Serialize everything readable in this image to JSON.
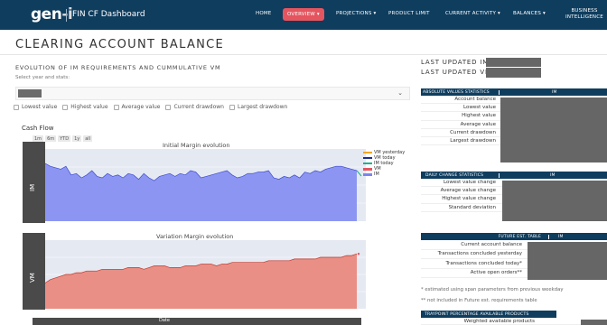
{
  "nav": {
    "logo_main": "gen",
    "logo_dash": "-i",
    "app_title": "FIN CF Dashboard",
    "items": [
      {
        "label": "HOME"
      },
      {
        "label": "OVERVIEW ▾"
      },
      {
        "label": "PROJECTIONS ▾"
      },
      {
        "label": "PRODUCT LIMIT"
      },
      {
        "label": "CURRENT ACTIVITY ▾"
      },
      {
        "label": "BALANCES ▾"
      }
    ],
    "bi_line1": "BUSINESS",
    "bi_line2": "INTELLIGENCE",
    "active_color": "#e4555f",
    "bg_color": "#0f3d5e"
  },
  "page": {
    "title": "CLEARING ACCOUNT BALANCE",
    "section_title": "EVOLUTION OF IM REQUIREMENTS AND CUMMULATIVE VM",
    "select_hint": "Select year and stats:",
    "checkboxes": [
      "Lowest value",
      "Highest value",
      "Average value",
      "Current drawdown",
      "Largest drawdown"
    ]
  },
  "chart_header": {
    "title": "Cash Flow",
    "range_buttons": [
      "1m",
      "6m",
      "YTD",
      "1y",
      "all"
    ]
  },
  "chart_data": [
    {
      "type": "area",
      "title": "Initial Margin evolution",
      "ylabel": "IM",
      "series": [
        {
          "name": "IM",
          "color": "#8c96f2",
          "values": [
            100,
            98,
            97,
            96,
            98,
            92,
            93,
            90,
            92,
            95,
            91,
            90,
            93,
            91,
            92,
            90,
            93,
            92,
            89,
            93,
            90,
            88,
            91,
            92,
            93,
            91,
            93,
            92,
            95,
            94,
            90,
            91,
            92,
            93,
            94,
            95,
            92,
            90,
            91,
            93,
            93,
            94,
            94,
            95,
            90,
            89,
            91,
            90,
            92,
            90,
            94,
            93,
            95,
            94,
            96,
            97,
            98,
            98,
            97,
            96,
            95
          ]
        },
        {
          "name": "VM today",
          "color": "#1f2e8c",
          "values": []
        },
        {
          "name": "IM today",
          "color": "#19b28c",
          "values": []
        }
      ]
    },
    {
      "type": "area",
      "title": "Variation Margin evolution",
      "ylabel": "VM",
      "series": [
        {
          "name": "VM",
          "color": "#e8776e",
          "values": [
            10,
            12,
            13,
            14,
            15,
            15,
            16,
            16,
            17,
            17,
            17,
            18,
            18,
            18,
            18,
            18,
            19,
            19,
            19,
            18,
            19,
            20,
            20,
            20,
            19,
            19,
            19,
            20,
            20,
            20,
            21,
            21,
            21,
            20,
            21,
            21,
            22,
            22,
            22,
            22,
            22,
            22,
            22,
            23,
            23,
            23,
            23,
            23,
            24,
            24,
            24,
            24,
            24,
            25,
            25,
            25,
            25,
            25,
            26,
            26,
            27
          ]
        }
      ]
    }
  ],
  "legend": [
    {
      "name": "VM yesterday",
      "color": "#f5a623"
    },
    {
      "name": "VM today",
      "color": "#1f2e8c"
    },
    {
      "name": "IM today",
      "color": "#19b28c"
    },
    {
      "name": "VM",
      "color": "#e4555f"
    },
    {
      "name": "IM",
      "color": "#7a85f0"
    }
  ],
  "date_label": "Date",
  "right": {
    "last_updated_im": "LAST UPDATED IM:",
    "last_updated_vm": "LAST UPDATED VM:",
    "abs_table": {
      "head_label": "ABSOLUTE VALUES STATISTICS",
      "head_col": "IM",
      "rows": [
        "Account balance",
        "Lowest value",
        "Highest value",
        "Average value",
        "Current drawdown",
        "Largest drawdown"
      ]
    },
    "daily_table": {
      "head_label": "DAILY CHANGE STATISTICS",
      "head_col": "IM",
      "rows": [
        "Lowest value change",
        "Average value change",
        "Highest value change",
        "Standard deviation"
      ]
    },
    "future_table": {
      "head_label": "FUTURE EST. TABLE",
      "head_col": "IM",
      "rows": [
        "Current account balance",
        "Transactions concluded yesterday",
        "Transactions concluded today*",
        "Active open orders**"
      ]
    },
    "note1": "* estimated using span parameters from previous weekday",
    "note2": "** not included in Future est. requirements table",
    "traypoint_table": {
      "head_label": "TRAYPOINT PERCENTAGE AVAILABLE PRODUCTS",
      "row": "Weighted available products"
    }
  }
}
